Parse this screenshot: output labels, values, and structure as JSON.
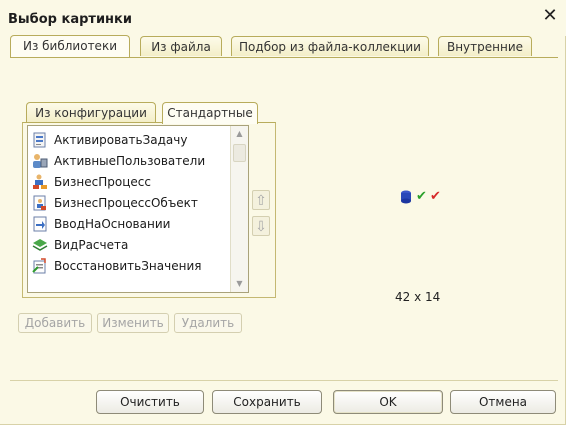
{
  "window": {
    "title": "Выбор картинки",
    "close_glyph": "✕"
  },
  "tabs_top": [
    {
      "label": "Из библиотеки",
      "active": true
    },
    {
      "label": "Из файла",
      "active": false
    },
    {
      "label": "Подбор из файла-коллекции",
      "active": false
    },
    {
      "label": "Внутренние",
      "active": false
    }
  ],
  "tabs_inner": [
    {
      "label": "Из конфигурации",
      "active": false
    },
    {
      "label": "Стандартные",
      "active": true
    }
  ],
  "library_list": [
    {
      "label": "АктивироватьЗадачу",
      "icon": "activate-task-icon"
    },
    {
      "label": "АктивныеПользователи",
      "icon": "active-users-icon"
    },
    {
      "label": "БизнесПроцесс",
      "icon": "business-process-icon"
    },
    {
      "label": "БизнесПроцессОбъект",
      "icon": "business-process-object-icon"
    },
    {
      "label": "ВводНаОсновании",
      "icon": "input-on-basis-icon"
    },
    {
      "label": "ВидРасчета",
      "icon": "calculation-type-icon"
    },
    {
      "label": "ВосстановитьЗначения",
      "icon": "restore-values-icon"
    }
  ],
  "list_actions": {
    "add": "Добавить",
    "edit": "Изменить",
    "delete": "Удалить"
  },
  "preview": {
    "size_text": "42 x 14"
  },
  "footer": {
    "clear": "Очистить",
    "save": "Сохранить",
    "ok": "OK",
    "cancel": "Отмена"
  },
  "colors": {
    "window_bg": "#fbf9e6",
    "tab_border": "#b8ac5c",
    "disabled_text": "#a5a5a5"
  }
}
